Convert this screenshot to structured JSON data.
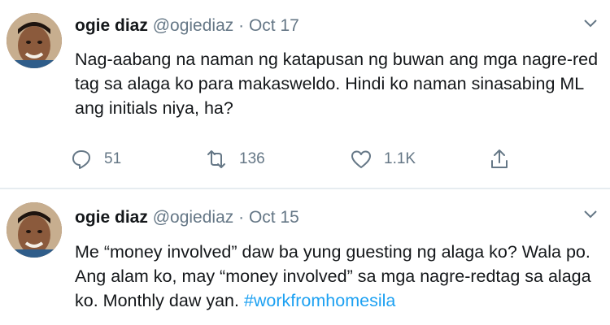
{
  "tweets": [
    {
      "name": "ogie diaz",
      "handle": "@ogiediaz",
      "separator": "·",
      "date": "Oct 17",
      "text": "Nag-aabang na naman ng katapusan ng buwan ang mga nagre-red tag sa alaga ko para makasweldo. Hindi ko naman sinasabing ML ang initials niya, ha?",
      "replies": "51",
      "retweets": "136",
      "likes": "1.1K"
    },
    {
      "name": "ogie diaz",
      "handle": "@ogiediaz",
      "separator": "·",
      "date": "Oct 15",
      "text": "Me “money involved” daw ba yung guesting ng alaga ko? Wala po. Ang alam ko, may “money involved” sa mga nagre-redtag sa alaga ko. Monthly daw yan. ",
      "hashtag": "#workfromhomesila"
    }
  ],
  "colors": {
    "accent": "#1da1f2",
    "secondary_text": "#657786",
    "divider": "#e6ecf0"
  },
  "icons": [
    "reply-icon",
    "retweet-icon",
    "like-icon",
    "share-icon",
    "caret-down-icon"
  ]
}
